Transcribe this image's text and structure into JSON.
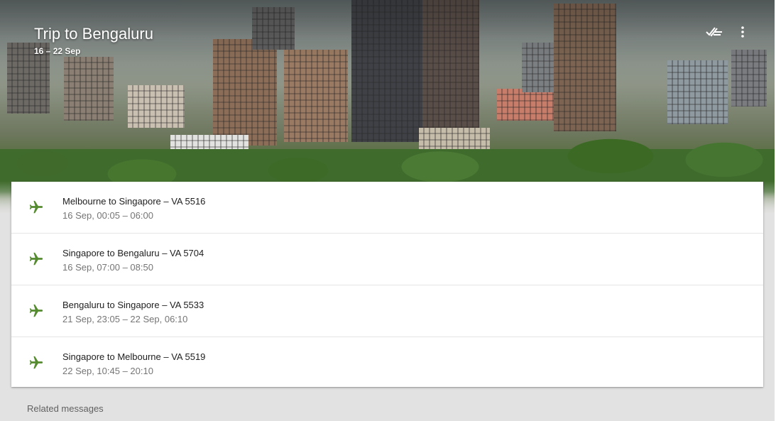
{
  "trip": {
    "title": "Trip to Bengaluru",
    "dates": "16 – 22 Sep"
  },
  "header_actions": {
    "done_icon": "done-all-icon",
    "more_icon": "more-vert-icon"
  },
  "flights": [
    {
      "title": "Melbourne to Singapore – VA 5516",
      "time": "16 Sep, 00:05 – 06:00",
      "icon": "airplane-icon"
    },
    {
      "title": "Singapore to Bengaluru – VA 5704",
      "time": "16 Sep, 07:00 – 08:50",
      "icon": "airplane-icon"
    },
    {
      "title": "Bengaluru to Singapore – VA 5533",
      "time": "21 Sep, 23:05 – 22 Sep, 06:10",
      "icon": "airplane-icon"
    },
    {
      "title": "Singapore to Melbourne – VA 5519",
      "time": "22 Sep, 10:45 – 20:10",
      "icon": "airplane-icon"
    }
  ],
  "related_messages_label": "Related messages",
  "colors": {
    "icon_green": "#558b2f",
    "background": "#e2e2e2",
    "card": "#ffffff"
  }
}
